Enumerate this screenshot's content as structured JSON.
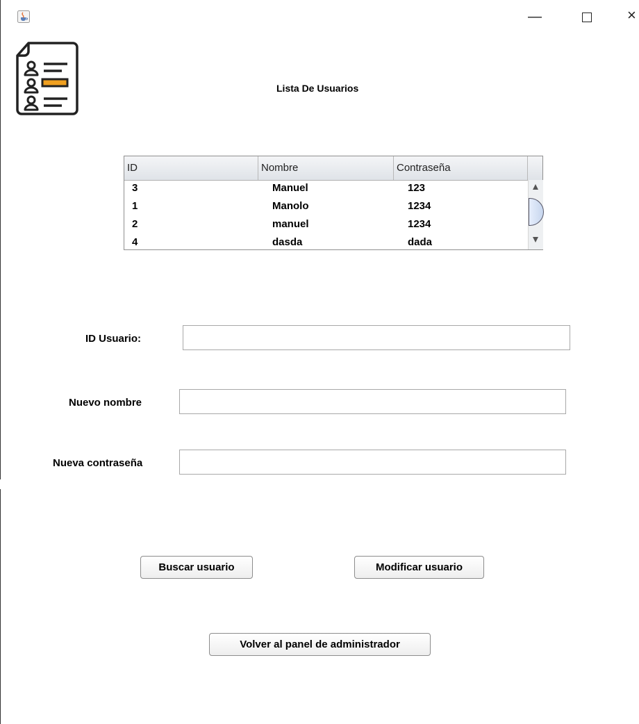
{
  "window": {
    "app_icon": "java-cup-icon",
    "minimize_glyph": "—",
    "close_glyph": "×"
  },
  "header": {
    "logo_icon": "user-list-icon",
    "title": "Lista De Usuarios"
  },
  "table": {
    "columns": [
      "ID",
      "Nombre",
      "Contraseña"
    ],
    "rows": [
      {
        "id": "3",
        "nombre": "Manuel",
        "contrasena": "123"
      },
      {
        "id": "1",
        "nombre": "Manolo",
        "contrasena": "1234"
      },
      {
        "id": "2",
        "nombre": "manuel",
        "contrasena": "1234"
      },
      {
        "id": "4",
        "nombre": "dasda",
        "contrasena": "dada"
      }
    ]
  },
  "form": {
    "id_label": "ID Usuario:",
    "id_value": "",
    "name_label": "Nuevo nombre",
    "name_value": "",
    "password_label": "Nueva contraseña",
    "password_value": ""
  },
  "buttons": {
    "search": "Buscar usuario",
    "modify": "Modificar usuario",
    "back": "Volver al panel de administrador"
  },
  "colors": {
    "accent": "#f0a020",
    "header_bg": "#e4e7eb",
    "border": "#a8a8a8"
  }
}
